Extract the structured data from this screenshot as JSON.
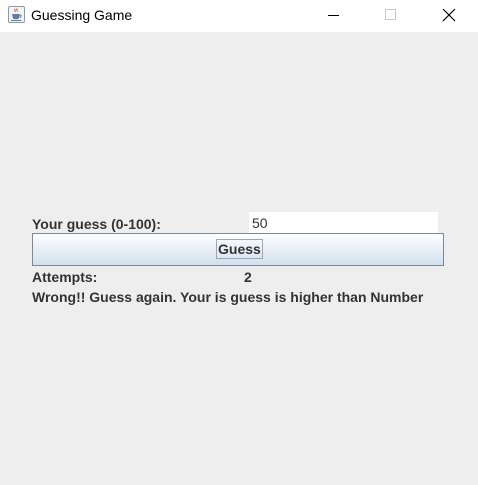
{
  "window": {
    "title": "Guessing Game",
    "app_icon": "java-cup-icon",
    "controls": [
      "minimize-icon",
      "maximize-icon",
      "close-icon"
    ]
  },
  "form": {
    "guess_label": "Your guess (0-100):",
    "guess_value": "50",
    "guess_button": "Guess",
    "attempts_label": "Attempts:",
    "attempts_value": "2",
    "message": "Wrong!! Guess again. Your is guess is higher than Number"
  },
  "colors": {
    "background": "#eeeeee",
    "text": "#333333",
    "button_gradient_top": "#ffffff",
    "button_gradient_bottom": "#d4e0ee",
    "button_border": "#7a8a99"
  }
}
